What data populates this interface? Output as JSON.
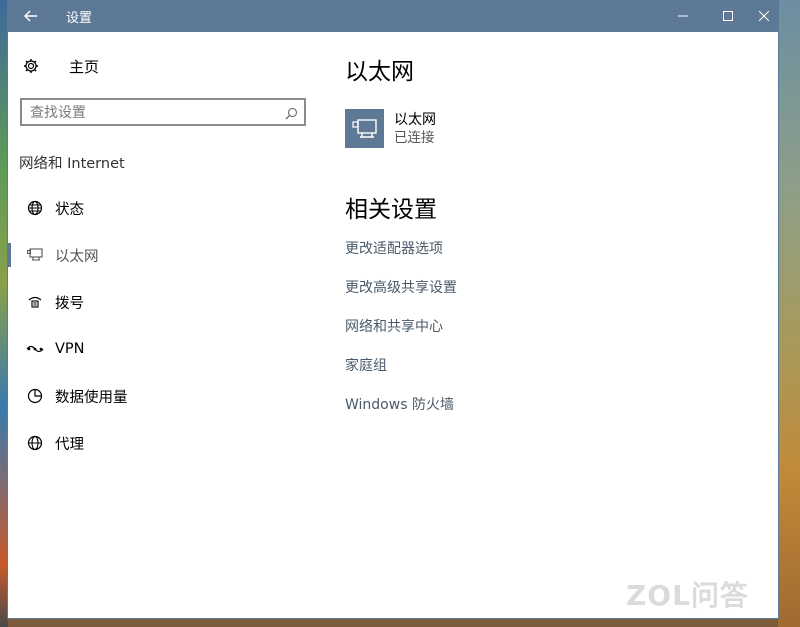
{
  "window": {
    "title": "设置"
  },
  "nav": {
    "home_label": "主页",
    "search_placeholder": "查找设置",
    "section_heading": "网络和 Internet",
    "items": [
      {
        "label": "状态",
        "icon": "globe-status-icon"
      },
      {
        "label": "以太网",
        "icon": "ethernet-icon",
        "selected": true
      },
      {
        "label": "拨号",
        "icon": "dialup-icon"
      },
      {
        "label": "VPN",
        "icon": "vpn-icon"
      },
      {
        "label": "数据使用量",
        "icon": "data-usage-icon"
      },
      {
        "label": "代理",
        "icon": "globe-icon"
      }
    ]
  },
  "content": {
    "page_title": "以太网",
    "adapter": {
      "name": "以太网",
      "status": "已连接"
    },
    "related_title": "相关设置",
    "links": [
      "更改适配器选项",
      "更改高级共享设置",
      "网络和共享中心",
      "家庭组",
      "Windows 防火墙"
    ]
  },
  "watermark": "ZOL问答",
  "colors": {
    "titlebar": "#5e7996",
    "tile": "#5e7996",
    "link": "#4a5a6a"
  }
}
